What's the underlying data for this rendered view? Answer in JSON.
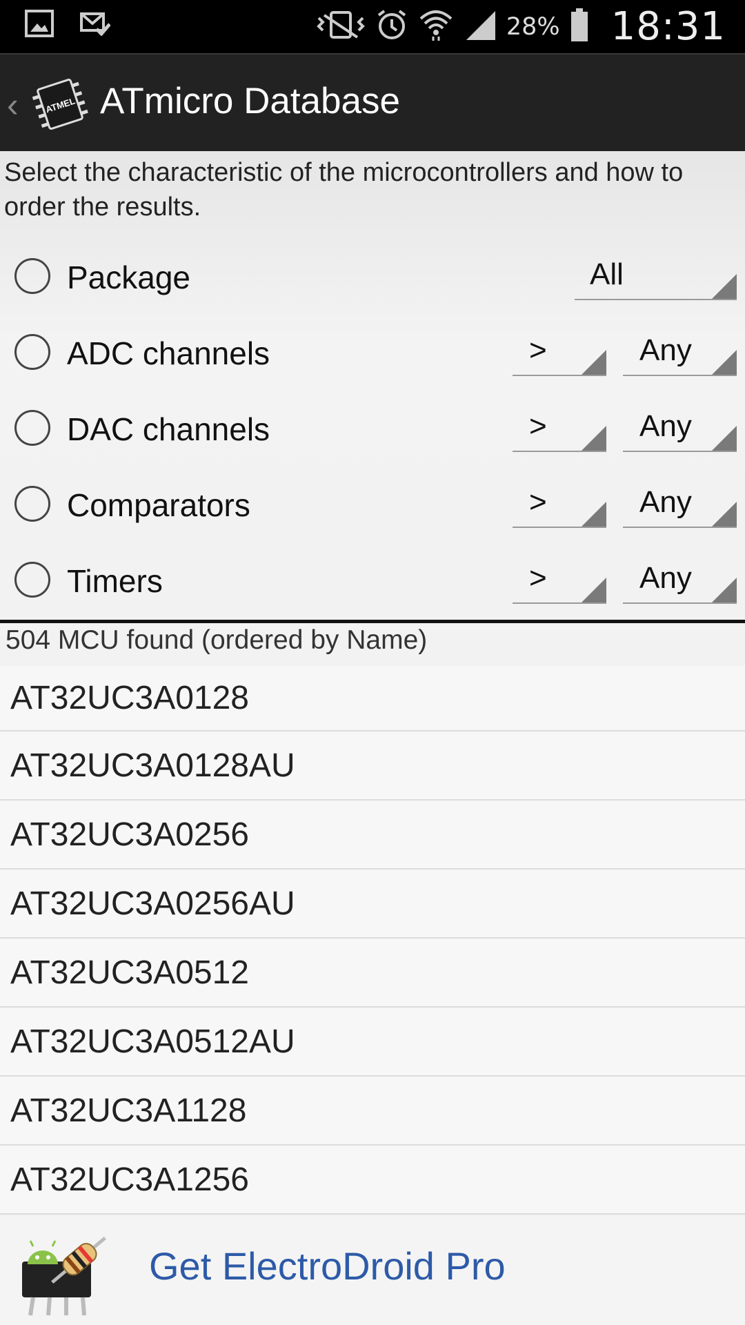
{
  "status_bar": {
    "battery_percent": "28%",
    "time": "18:31",
    "icons": [
      "gallery-icon",
      "mail-done-icon",
      "vibrate-icon",
      "alarm-icon",
      "wifi-icon",
      "signal-icon",
      "battery-icon"
    ]
  },
  "app_bar": {
    "title": "ATmicro Database",
    "logo_text": "ATMEL"
  },
  "filters": {
    "instructions": "Select the characteristic of the microcontrollers and how to order the results.",
    "rows": [
      {
        "label": "Package",
        "value": "All"
      },
      {
        "label": "ADC channels",
        "operator": ">",
        "value": "Any"
      },
      {
        "label": "DAC channels",
        "operator": ">",
        "value": "Any"
      },
      {
        "label": "Comparators",
        "operator": ">",
        "value": "Any"
      },
      {
        "label": "Timers",
        "operator": ">",
        "value": "Any"
      }
    ]
  },
  "results": {
    "header": "504 MCU found (ordered by Name)",
    "items": [
      "AT32UC3A0128",
      "AT32UC3A0128AU",
      "AT32UC3A0256",
      "AT32UC3A0256AU",
      "AT32UC3A0512",
      "AT32UC3A0512AU",
      "AT32UC3A1128",
      "AT32UC3A1256"
    ]
  },
  "promo": {
    "label": "Get ElectroDroid Pro"
  },
  "colors": {
    "status_bar_bg": "#000000",
    "app_bar_bg": "#222222",
    "promo_text": "#2d5aa8"
  }
}
